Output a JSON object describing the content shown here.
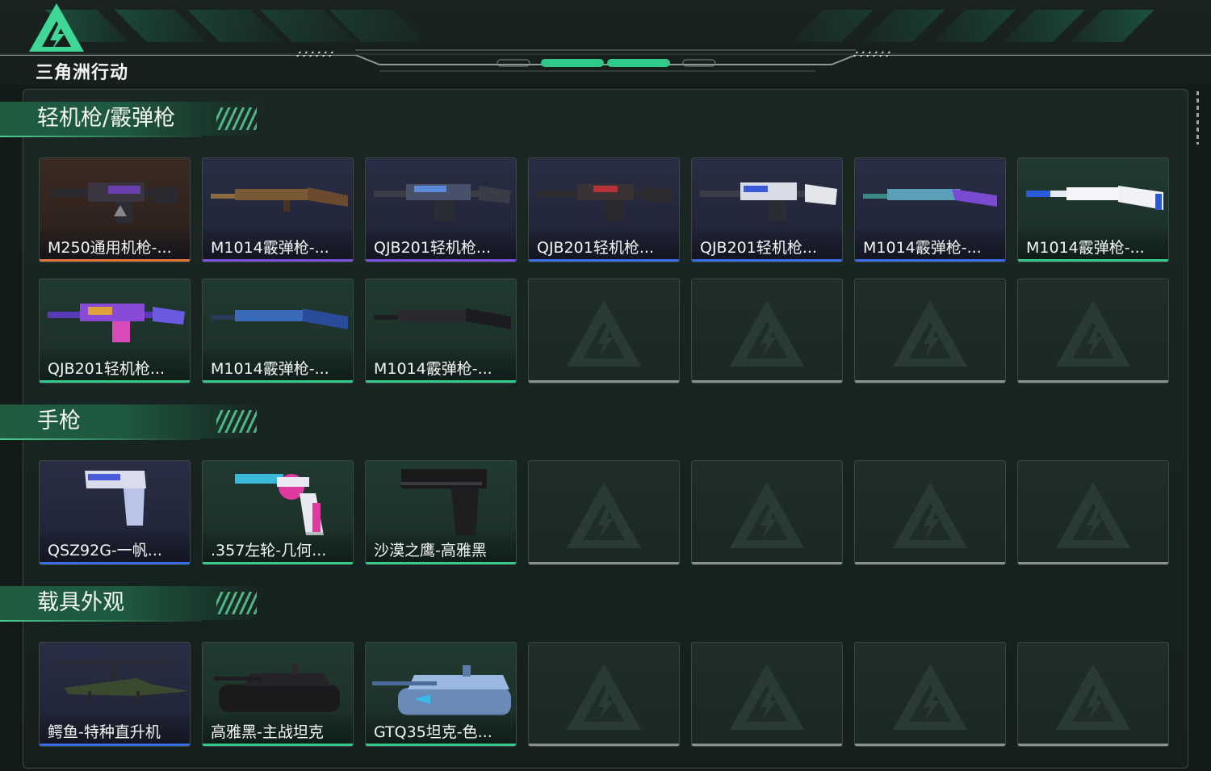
{
  "app": {
    "title": "三角洲行动"
  },
  "sections": [
    {
      "title": "轻机枪/霰弹枪",
      "items": [
        {
          "name": "M250通用机枪-...",
          "rarity": "orange",
          "art": "lmg-dark"
        },
        {
          "name": "M1014霰弹枪-...",
          "rarity": "purple",
          "art": "shotgun-wood"
        },
        {
          "name": "QJB201轻机枪...",
          "rarity": "purple",
          "art": "lmg-blue"
        },
        {
          "name": "QJB201轻机枪...",
          "rarity": "blue",
          "art": "lmg-red"
        },
        {
          "name": "QJB201轻机枪...",
          "rarity": "blue",
          "art": "lmg-white"
        },
        {
          "name": "M1014霰弹枪-...",
          "rarity": "blue",
          "art": "shotgun-teal"
        },
        {
          "name": "M1014霰弹枪-...",
          "rarity": "green",
          "art": "shotgun-white"
        },
        {
          "name": "QJB201轻机枪...",
          "rarity": "green",
          "art": "lmg-galaxy"
        },
        {
          "name": "M1014霰弹枪-...",
          "rarity": "green",
          "art": "shotgun-blue"
        },
        {
          "name": "M1014霰弹枪-...",
          "rarity": "green",
          "art": "shotgun-black"
        },
        {
          "empty": true
        },
        {
          "empty": true
        },
        {
          "empty": true
        },
        {
          "empty": true
        }
      ]
    },
    {
      "title": "手枪",
      "items": [
        {
          "name": "QSZ92G-一帆...",
          "rarity": "blue",
          "art": "pistol-paint"
        },
        {
          "name": ".357左轮-几何...",
          "rarity": "green",
          "art": "revolver-pink"
        },
        {
          "name": "沙漠之鹰-高雅黑",
          "rarity": "green",
          "art": "deagle-black"
        },
        {
          "empty": true
        },
        {
          "empty": true
        },
        {
          "empty": true
        },
        {
          "empty": true
        }
      ]
    },
    {
      "title": "载具外观",
      "items": [
        {
          "name": "鳄鱼-特种直升机",
          "rarity": "blue",
          "art": "helicopter"
        },
        {
          "name": "高雅黑-主战坦克",
          "rarity": "green",
          "art": "tank-black"
        },
        {
          "name": "GTQ35坦克-色...",
          "rarity": "green",
          "art": "tank-blue"
        },
        {
          "empty": true
        },
        {
          "empty": true
        },
        {
          "empty": true
        },
        {
          "empty": true
        }
      ]
    }
  ],
  "colors": {
    "orange": "#e0743a",
    "purple": "#7a4fe0",
    "blue": "#3a6be6",
    "green": "#36c98a",
    "accent": "#3fd696"
  }
}
